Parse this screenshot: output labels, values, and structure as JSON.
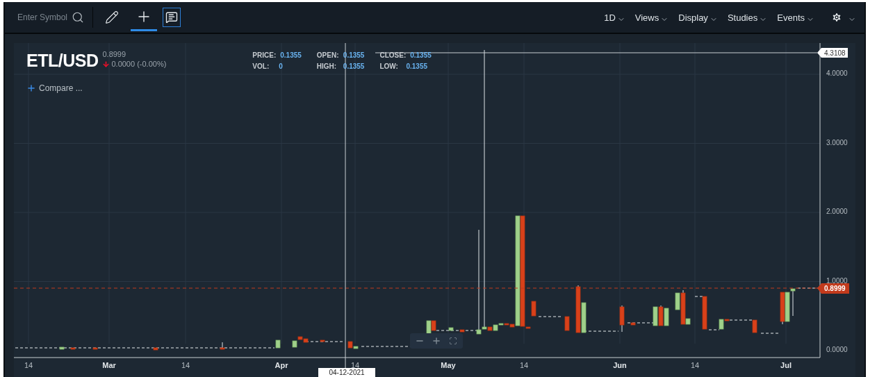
{
  "toolbar": {
    "search": {
      "placeholder": "Enter Symbol"
    },
    "tools": [
      {
        "kind": "draw",
        "selected": false,
        "active": false
      },
      {
        "kind": "crosshair",
        "selected": true,
        "active": false
      },
      {
        "kind": "comment",
        "selected": false,
        "active": true
      }
    ],
    "menus": [
      {
        "kind": "text",
        "label": "1D"
      },
      {
        "kind": "text",
        "label": "Views"
      },
      {
        "kind": "text",
        "label": "Display"
      },
      {
        "kind": "text",
        "label": "Studies"
      },
      {
        "kind": "text",
        "label": "Events"
      },
      {
        "kind": "settings"
      }
    ]
  },
  "header": {
    "symbol": "ETL/USD",
    "last": "0.8999",
    "change": "0.0000 (-0.00%)",
    "stats": [
      {
        "label": "PRICE:",
        "value": "0.1355"
      },
      {
        "label": "OPEN:",
        "value": "0.1355"
      },
      {
        "label": "CLOSE:",
        "value": "0.1355"
      },
      {
        "label": "VOL:",
        "value": "0"
      },
      {
        "label": "HIGH:",
        "value": "0.1355"
      },
      {
        "label": "LOW:",
        "value": "0.1355"
      }
    ],
    "compare": "Compare ..."
  },
  "chart": {
    "y_labels": [
      "4.0000",
      "3.0000",
      "2.0000",
      "1.0000",
      "0.0000"
    ],
    "x_labels": [
      {
        "label": "14",
        "major": false
      },
      {
        "label": "Mar",
        "major": true
      },
      {
        "label": "14",
        "major": false
      },
      {
        "label": "Apr",
        "major": true
      },
      {
        "label": "14",
        "major": false
      },
      {
        "label": "May",
        "major": true
      },
      {
        "label": "14",
        "major": false
      },
      {
        "label": "Jun",
        "major": true
      },
      {
        "label": "14",
        "major": false
      },
      {
        "label": "Jul",
        "major": true
      }
    ],
    "crosshair_value": "4.3108",
    "crosshair_date": "04-12-2021",
    "current_price": "0.8999"
  }
}
